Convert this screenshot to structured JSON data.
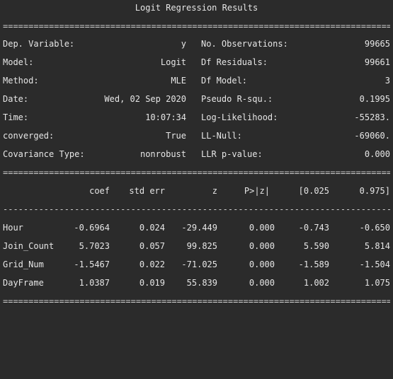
{
  "title": "Logit Regression Results",
  "rules": {
    "double": "========================================================================================================",
    "single": "--------------------------------------------------------------------------------------------------------"
  },
  "summary": [
    {
      "l_label": "Dep. Variable:",
      "l_value": "y",
      "r_label": "No. Observations:",
      "r_value": "99665"
    },
    {
      "l_label": "Model:",
      "l_value": "Logit",
      "r_label": "Df Residuals:",
      "r_value": "99661"
    },
    {
      "l_label": "Method:",
      "l_value": "MLE",
      "r_label": "Df Model:",
      "r_value": "3"
    },
    {
      "l_label": "Date:",
      "l_value": "Wed, 02 Sep 2020",
      "r_label": "Pseudo R-squ.:",
      "r_value": "0.1995"
    },
    {
      "l_label": "Time:",
      "l_value": "10:07:34",
      "r_label": "Log-Likelihood:",
      "r_value": "-55283."
    },
    {
      "l_label": "converged:",
      "l_value": "True",
      "r_label": "LL-Null:",
      "r_value": "-69060."
    },
    {
      "l_label": "Covariance Type:",
      "l_value": "nonrobust",
      "r_label": "LLR p-value:",
      "r_value": "0.000"
    }
  ],
  "coef_header": [
    "coef",
    "std err",
    "z",
    "P>|z|",
    "[0.025",
    "0.975]"
  ],
  "coef_rows": [
    {
      "name": "Hour",
      "values": [
        "-0.6964",
        "0.024",
        "-29.449",
        "0.000",
        "-0.743",
        "-0.650"
      ]
    },
    {
      "name": "Join_Count",
      "values": [
        "5.7023",
        "0.057",
        "99.825",
        "0.000",
        "5.590",
        "5.814"
      ]
    },
    {
      "name": "Grid_Num",
      "values": [
        "-1.5467",
        "0.022",
        "-71.025",
        "0.000",
        "-1.589",
        "-1.504"
      ]
    },
    {
      "name": "DayFrame",
      "values": [
        "1.0387",
        "0.019",
        "55.839",
        "0.000",
        "1.002",
        "1.075"
      ]
    }
  ]
}
